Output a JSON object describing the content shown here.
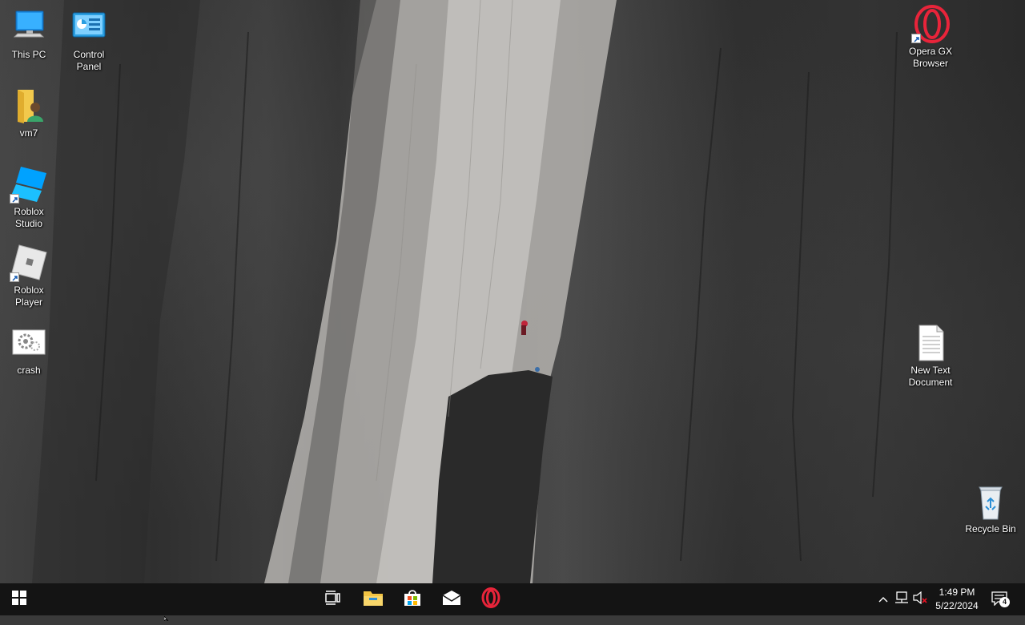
{
  "desktop": {
    "icons": [
      {
        "id": "this-pc",
        "label": "This PC"
      },
      {
        "id": "control-panel",
        "label": "Control\nPanel"
      },
      {
        "id": "vm7",
        "label": "vm7"
      },
      {
        "id": "roblox-studio",
        "label": "Roblox\nStudio"
      },
      {
        "id": "roblox-player",
        "label": "Roblox\nPlayer"
      },
      {
        "id": "crash",
        "label": "crash"
      },
      {
        "id": "opera-gx",
        "label": "Opera GX\nBrowser"
      },
      {
        "id": "new-text-document",
        "label": "New Text\nDocument"
      },
      {
        "id": "recycle-bin",
        "label": "Recycle Bin"
      }
    ]
  },
  "taskbar": {
    "start_icon": "windows-logo-icon",
    "pinned": [
      {
        "icon": "task-view-icon"
      },
      {
        "icon": "file-explorer-icon"
      },
      {
        "icon": "microsoft-store-icon"
      },
      {
        "icon": "mail-icon"
      },
      {
        "icon": "opera-gx-icon"
      }
    ],
    "tray": {
      "icons": [
        "chevron-up-icon",
        "network-icon",
        "volume-muted-icon"
      ],
      "time": "1:49 PM",
      "date": "5/22/2024",
      "notification_count": "4"
    }
  }
}
